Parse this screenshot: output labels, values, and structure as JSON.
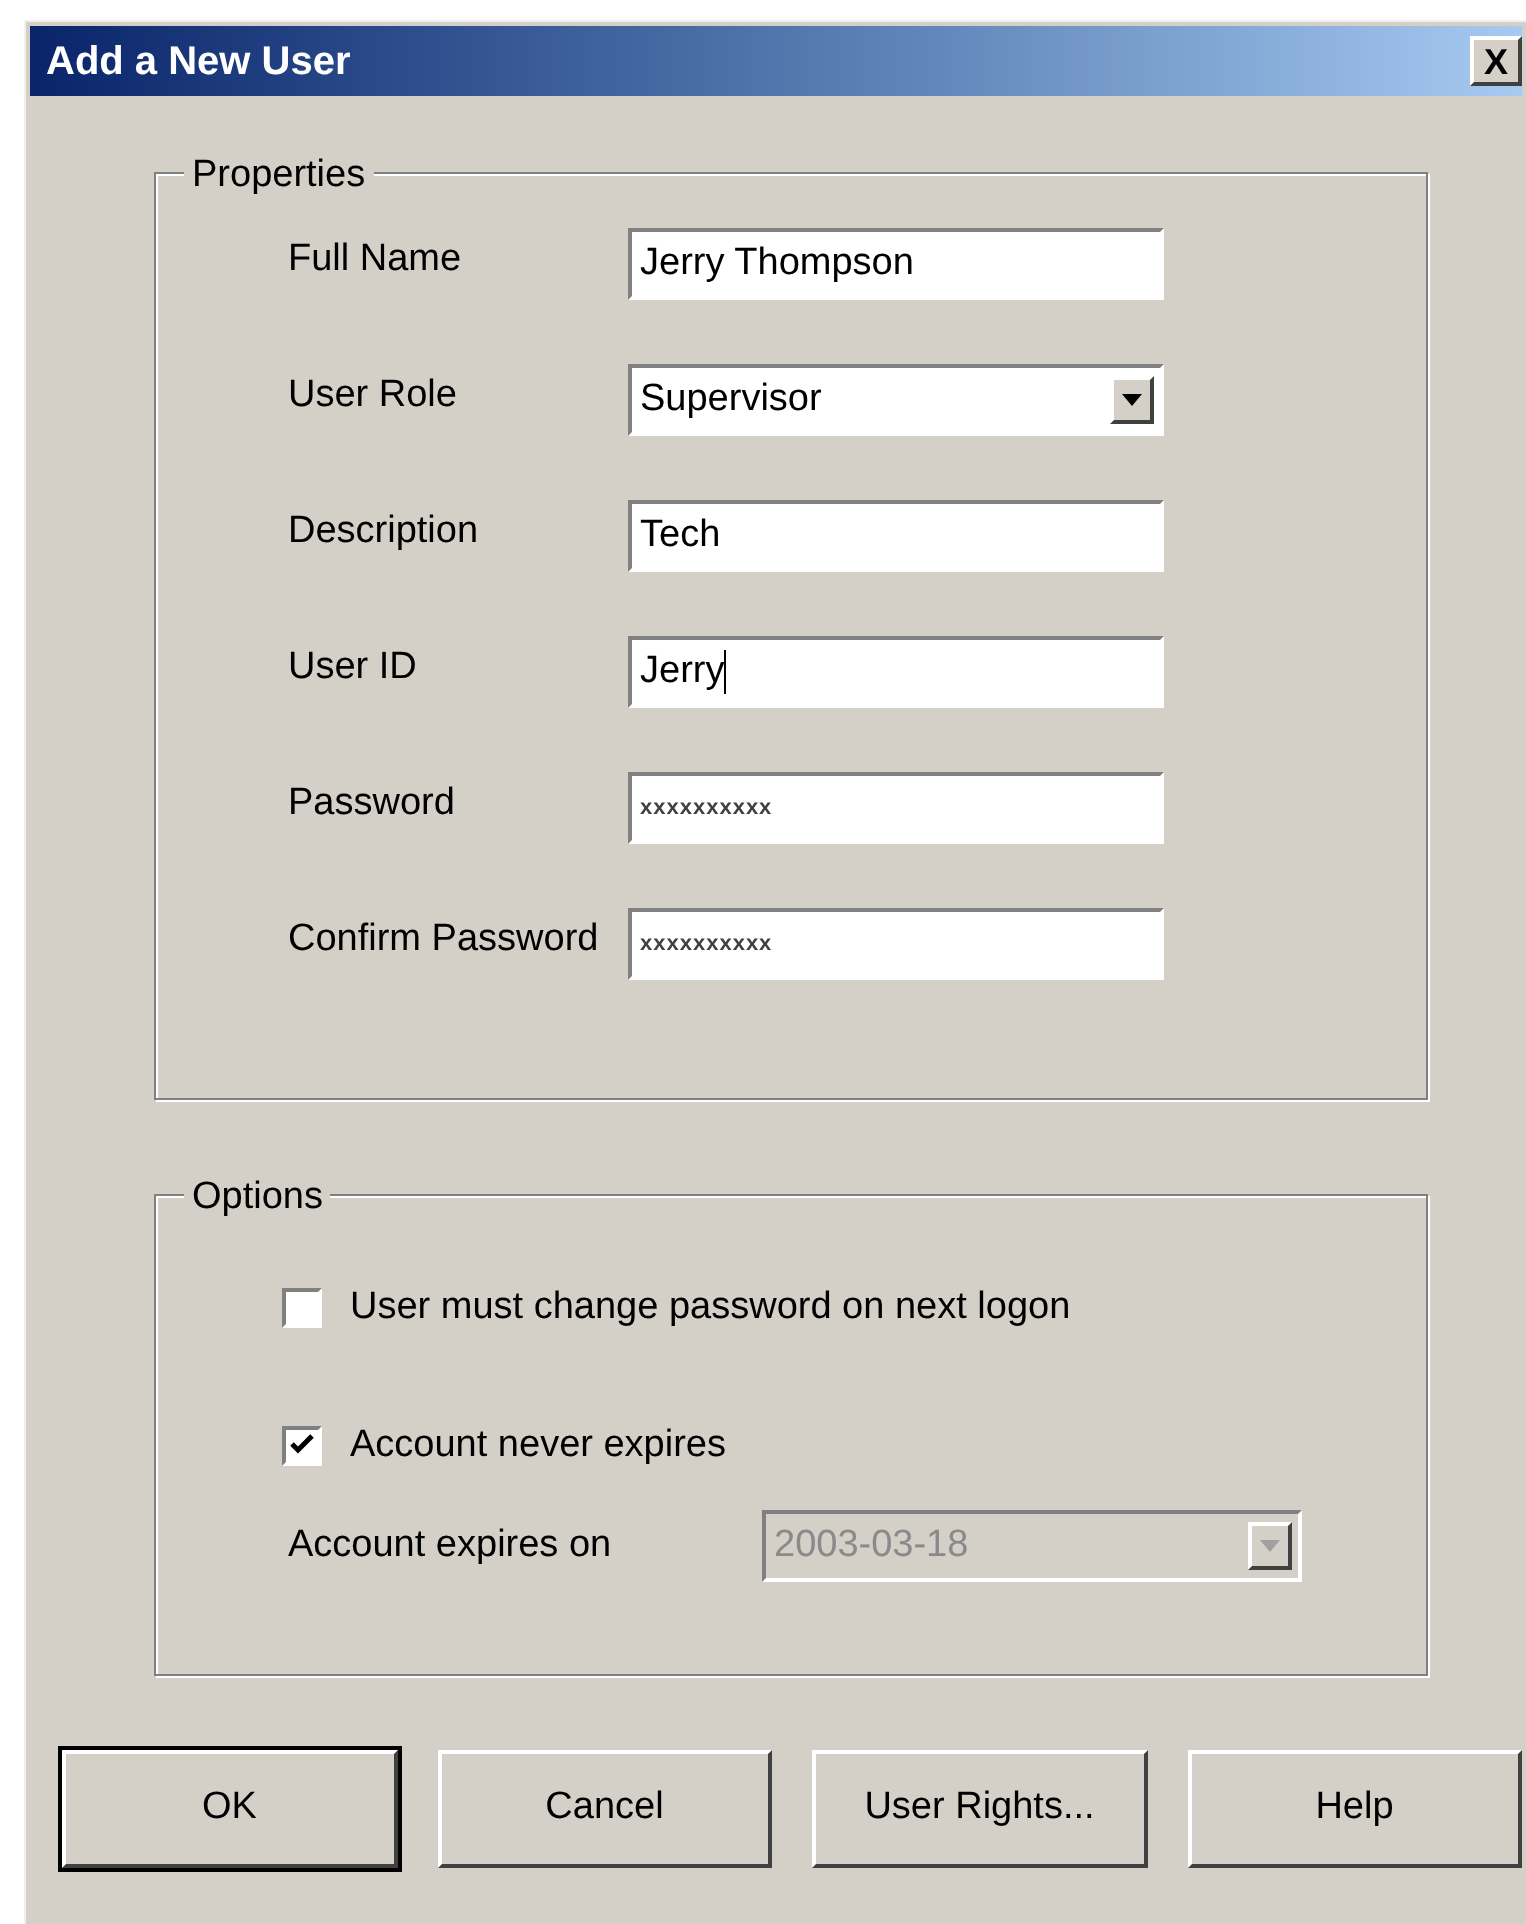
{
  "window": {
    "title": "Add a New User",
    "close": "X"
  },
  "properties": {
    "title": "Properties",
    "fields": [
      {
        "label": "Full Name",
        "kind": "text",
        "value": "Jerry Thompson"
      },
      {
        "label": "User Role",
        "kind": "select",
        "value": "Supervisor"
      },
      {
        "label": "Description",
        "kind": "text",
        "value": "Tech"
      },
      {
        "label": "User ID",
        "kind": "text",
        "value": "Jerry",
        "focused": true
      },
      {
        "label": "Password",
        "kind": "password",
        "value": "xxxxxxxxxx"
      },
      {
        "label": "Confirm Password",
        "kind": "password",
        "value": "xxxxxxxxxx"
      }
    ]
  },
  "options": {
    "title": "Options",
    "checkboxes": [
      {
        "label": "User must change password on next logon",
        "checked": false
      },
      {
        "label": "Account never expires",
        "checked": true
      }
    ],
    "expires": {
      "label": "Account expires on",
      "value": "2003-03-18",
      "disabled": true
    }
  },
  "buttons": [
    {
      "label": "OK",
      "default": true
    },
    {
      "label": "Cancel",
      "default": false
    },
    {
      "label": "User Rights...",
      "default": false
    },
    {
      "label": "Help",
      "default": false
    }
  ]
}
